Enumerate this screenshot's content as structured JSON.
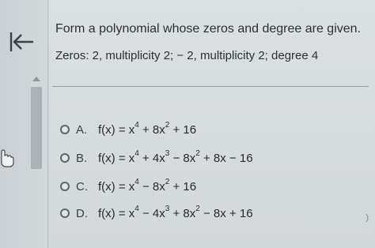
{
  "question": {
    "prompt": "Form a polynomial whose zeros and degree are given.",
    "given": "Zeros: 2, multiplicity 2;  − 2, multiplicity 2;  degree 4"
  },
  "options": [
    {
      "letter": "A.",
      "parts": [
        "f(x) = x",
        "4",
        " + 8x",
        "2",
        " + 16",
        "",
        ""
      ]
    },
    {
      "letter": "B.",
      "parts": [
        "f(x) = x",
        "4",
        " + 4x",
        "3",
        " − 8x",
        "2",
        " + 8x − 16"
      ]
    },
    {
      "letter": "C.",
      "parts": [
        "f(x) = x",
        "4",
        " − 8x",
        "2",
        " + 16",
        "",
        ""
      ]
    },
    {
      "letter": "D.",
      "parts": [
        "f(x) = x",
        "4",
        " − 4x",
        "3",
        " + 8x",
        "2",
        " − 8x + 16"
      ]
    }
  ],
  "icons": {
    "back": "back-arrow-icon",
    "cursor": "hand-pointer-icon",
    "scroll_up": "chevron-up-icon"
  },
  "colors": {
    "background": "#d3d8db",
    "text": "#2b3038",
    "radio_border": "#5d6670"
  }
}
